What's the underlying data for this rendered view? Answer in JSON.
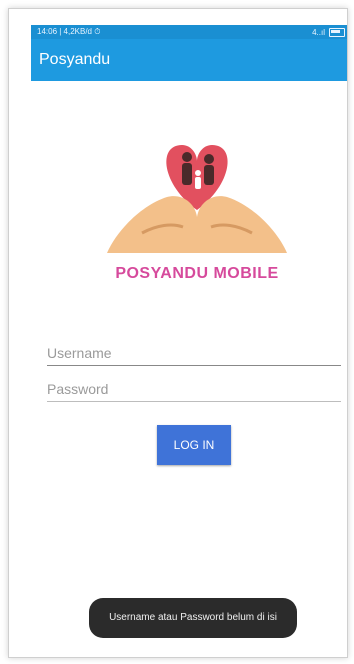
{
  "statusbar": {
    "time": "14:06 | 4,2KB/d ⏱",
    "signal": "4..ıl"
  },
  "appbar": {
    "title": "Posyandu"
  },
  "logo": {
    "text": "POSYANDU MOBILE"
  },
  "login": {
    "username_placeholder": "Username",
    "password_placeholder": "Password",
    "button_label": "LOG IN"
  },
  "toast": {
    "message": "Username atau Password belum di isi"
  },
  "colors": {
    "appbar": "#1e9ae0",
    "button": "#3f73d8",
    "logo_text": "#d64a9c",
    "toast_bg": "#2b2b2b"
  }
}
